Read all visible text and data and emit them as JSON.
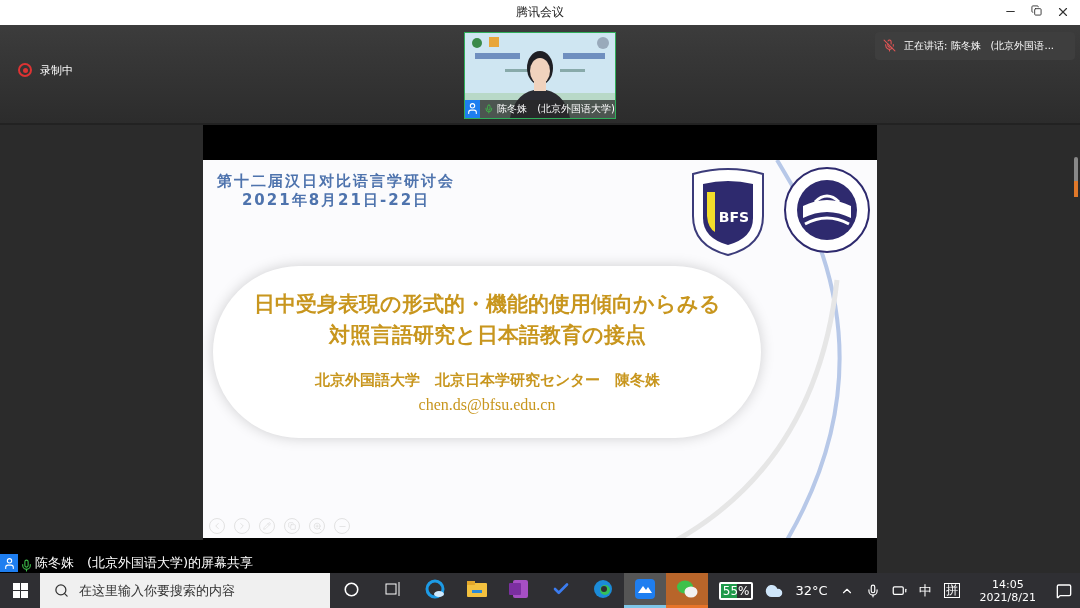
{
  "window": {
    "title": "腾讯会议"
  },
  "recording": {
    "label": "录制中",
    "active": true
  },
  "speaker_video": {
    "name": "陈冬姝　(北京外国语大学)",
    "mic_on": true
  },
  "speaking_now": {
    "text": "正在讲话: 陈冬姝　(北京外国语...",
    "mic_muted": true
  },
  "slide": {
    "conference": "第十二届汉日对比语言学研讨会",
    "dates": "2021年8月21日-22日",
    "logo_text": "BFS",
    "title_lines": [
      "日中受身表現の形式的・機能的使用傾向からみる",
      "対照言語研究と日本語教育の接点"
    ],
    "affiliation": "北京外国語大学　北京日本学研究センター　陳冬姝",
    "email": "chen.ds@bfsu.edu.cn"
  },
  "share_label": "陈冬姝　(北京外国语大学)的屏幕共享",
  "taskbar": {
    "search_placeholder": "在这里输入你要搜索的内容",
    "apps": [
      {
        "kind": "cortana",
        "selected": false,
        "flashing": false
      },
      {
        "kind": "taskview",
        "selected": false,
        "flashing": false
      },
      {
        "kind": "browser",
        "selected": false,
        "flashing": false
      },
      {
        "kind": "folder",
        "selected": false,
        "flashing": false
      },
      {
        "kind": "onenote",
        "selected": false,
        "flashing": false
      },
      {
        "kind": "todo",
        "selected": false,
        "flashing": false
      },
      {
        "kind": "edge",
        "selected": false,
        "flashing": false
      },
      {
        "kind": "meeting",
        "selected": true,
        "flashing": false
      },
      {
        "kind": "chat",
        "selected": false,
        "flashing": true
      }
    ],
    "battery": "55%",
    "weather": "32°C",
    "ime": "中",
    "ime_mode": "拼",
    "time": "14:05",
    "date": "2021/8/21"
  }
}
